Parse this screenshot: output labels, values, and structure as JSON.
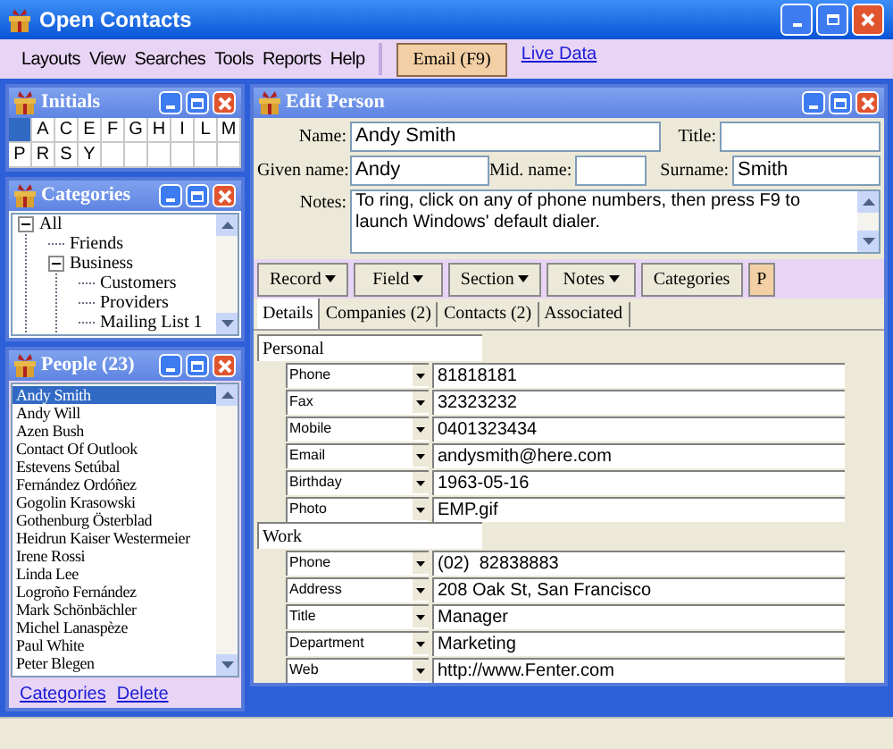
{
  "window": {
    "title": "Open Contacts"
  },
  "menu": [
    "Layouts",
    "View",
    "Searches",
    "Tools",
    "Reports",
    "Help"
  ],
  "email_button": "Email (F9)",
  "live_data_link": "Live Data",
  "initials_panel": {
    "title": "Initials",
    "all_cell_selected": true,
    "letters": [
      "A",
      "C",
      "E",
      "F",
      "G",
      "H",
      "I",
      "L",
      "M",
      "P",
      "R",
      "S",
      "Y"
    ]
  },
  "categories_panel": {
    "title": "Categories",
    "tree": [
      {
        "label": "All",
        "expanded": true,
        "children": [
          {
            "label": "Friends"
          },
          {
            "label": "Business",
            "expanded": true,
            "children": [
              {
                "label": "Customers"
              },
              {
                "label": "Providers"
              },
              {
                "label": "Mailing List 1"
              }
            ]
          }
        ]
      }
    ]
  },
  "people_panel": {
    "title": "People (23)",
    "people": [
      {
        "name": "Andy Smith",
        "selected": true
      },
      {
        "name": "Andy Will",
        "selected": false
      },
      {
        "name": "Azen Bush",
        "selected": false
      },
      {
        "name": "Contact Of Outlook",
        "selected": false
      },
      {
        "name": "Estevens Setúbal",
        "selected": false
      },
      {
        "name": "Fernández Ordóñez",
        "selected": false
      },
      {
        "name": "Gogolin Krasowski",
        "selected": false
      },
      {
        "name": "Gothenburg Österblad",
        "selected": false
      },
      {
        "name": "Heidrun Kaiser Westermeier",
        "selected": false
      },
      {
        "name": "Irene Rossi",
        "selected": false
      },
      {
        "name": "Linda Lee",
        "selected": false
      },
      {
        "name": "Logroño Fernández",
        "selected": false
      },
      {
        "name": "Mark Schönbächler",
        "selected": false
      },
      {
        "name": "Michel Lanaspèze",
        "selected": false
      },
      {
        "name": "Paul White",
        "selected": false
      },
      {
        "name": "Peter Blegen",
        "selected": false
      }
    ],
    "links": [
      "Categories",
      "Delete"
    ]
  },
  "edit_panel": {
    "title": "Edit Person",
    "name": {
      "label": "Name:",
      "value": "Andy Smith"
    },
    "title_field": {
      "label": "Title:"
    },
    "given_name": {
      "label": "Given name:",
      "value": "Andy"
    },
    "mid_name": {
      "label": "Mid. name:"
    },
    "surname": {
      "label": "Surname:",
      "value": "Smith"
    },
    "notes": {
      "label": "Notes:",
      "value": "To ring, click on any of phone numbers, then press F9 to launch Windows' default dialer."
    },
    "toolbar": [
      {
        "label": "Record",
        "dropdown": true,
        "highlighted": false
      },
      {
        "label": "Field",
        "dropdown": true,
        "highlighted": false
      },
      {
        "label": "Section",
        "dropdown": true,
        "highlighted": false
      },
      {
        "label": "Notes",
        "dropdown": true,
        "highlighted": false
      },
      {
        "label": "Categories",
        "dropdown": false,
        "highlighted": false
      },
      {
        "label": "P",
        "dropdown": false,
        "highlighted": true
      }
    ],
    "tabs": [
      {
        "label": "Details",
        "selected": true
      },
      {
        "label": "Companies (2)",
        "selected": false
      },
      {
        "label": "Contacts (2)",
        "selected": false
      },
      {
        "label": "Associated",
        "selected": false
      }
    ],
    "sections": [
      {
        "title": "Personal",
        "rows": [
          {
            "type": "Phone",
            "value": "81818181"
          },
          {
            "type": "Fax",
            "value": "32323232"
          },
          {
            "type": "Mobile",
            "value": "0401323434"
          },
          {
            "type": "Email",
            "value": "andysmith@here.com"
          },
          {
            "type": "Birthday",
            "value": "1963-05-16"
          },
          {
            "type": "Photo",
            "value": "EMP.gif"
          }
        ]
      },
      {
        "title": "Work",
        "rows": [
          {
            "type": "Phone",
            "value": "(02)  82838883"
          },
          {
            "type": "Address",
            "value": "208 Oak St, San Francisco"
          },
          {
            "type": "Title",
            "value": "Manager"
          },
          {
            "type": "Department",
            "value": "Marketing"
          },
          {
            "type": "Web",
            "value": "http://www.Fenter.com"
          }
        ]
      }
    ]
  }
}
